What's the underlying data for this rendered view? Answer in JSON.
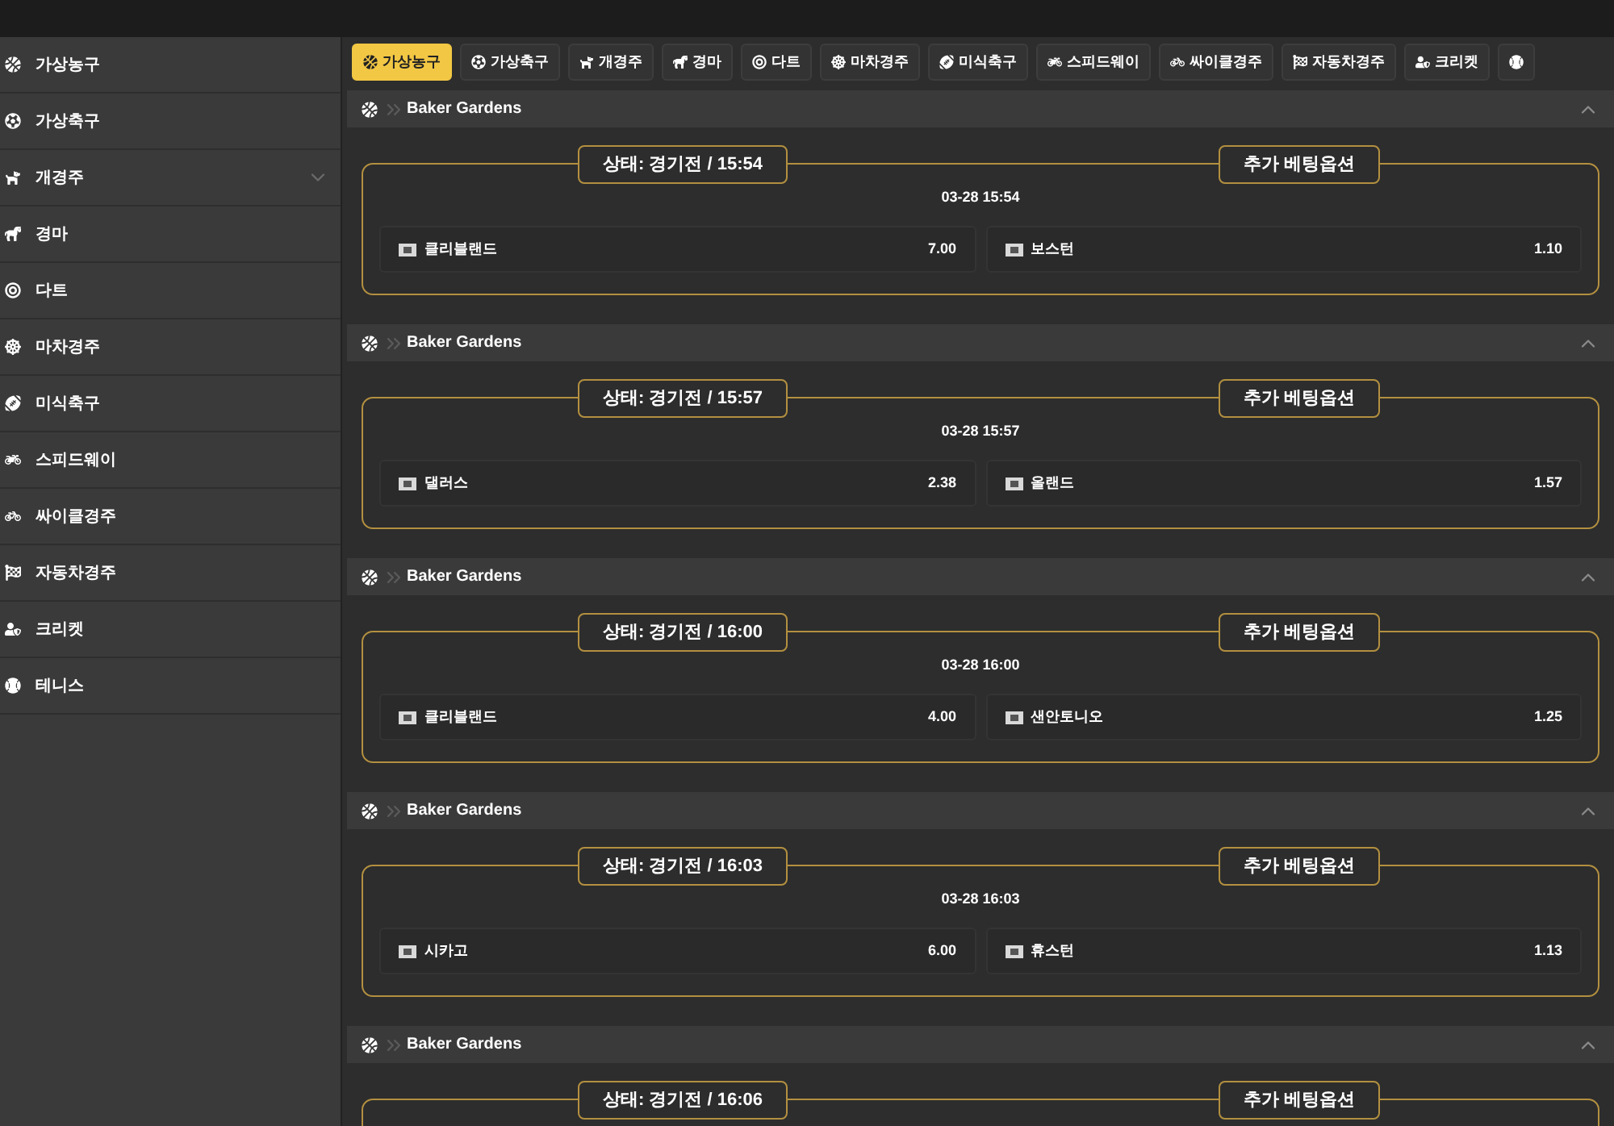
{
  "sidebar": {
    "items": [
      {
        "label": "가상농구",
        "kind": "basketball",
        "expandable": false
      },
      {
        "label": "가상축구",
        "kind": "soccer",
        "expandable": false
      },
      {
        "label": "개경주",
        "kind": "dog",
        "expandable": true
      },
      {
        "label": "경마",
        "kind": "horse",
        "expandable": false
      },
      {
        "label": "다트",
        "kind": "target",
        "expandable": false
      },
      {
        "label": "마차경주",
        "kind": "wheel",
        "expandable": false
      },
      {
        "label": "미식축구",
        "kind": "football",
        "expandable": false
      },
      {
        "label": "스피드웨이",
        "kind": "motorcycle",
        "expandable": false
      },
      {
        "label": "싸이클경주",
        "kind": "bicycle",
        "expandable": false
      },
      {
        "label": "자동차경주",
        "kind": "flag",
        "expandable": false
      },
      {
        "label": "크리켓",
        "kind": "person",
        "expandable": false
      },
      {
        "label": "테니스",
        "kind": "ball",
        "expandable": false
      }
    ]
  },
  "tabs": [
    {
      "label": "가상농구",
      "kind": "basketball",
      "selected": true
    },
    {
      "label": "가상축구",
      "kind": "soccer",
      "selected": false
    },
    {
      "label": "개경주",
      "kind": "dog",
      "selected": false
    },
    {
      "label": "경마",
      "kind": "horse",
      "selected": false
    },
    {
      "label": "다트",
      "kind": "target",
      "selected": false
    },
    {
      "label": "마차경주",
      "kind": "wheel",
      "selected": false
    },
    {
      "label": "미식축구",
      "kind": "football",
      "selected": false
    },
    {
      "label": "스피드웨이",
      "kind": "motorcycle",
      "selected": false
    },
    {
      "label": "싸이클경주",
      "kind": "bicycle",
      "selected": false
    },
    {
      "label": "자동차경주",
      "kind": "flag",
      "selected": false
    },
    {
      "label": "크리켓",
      "kind": "person",
      "selected": false
    },
    {
      "kind": "ball",
      "selected": false
    }
  ],
  "matches": [
    {
      "league": "Baker Gardens",
      "expanded": true,
      "status": "상태: 경기전 / 15:54",
      "extra": "추가 베팅옵션",
      "date": "03-28 15:54",
      "home": {
        "name": "클리블랜드",
        "odds": "7.00"
      },
      "away": {
        "name": "보스턴",
        "odds": "1.10"
      }
    },
    {
      "league": "Baker Gardens",
      "expanded": true,
      "status": "상태: 경기전 / 15:57",
      "extra": "추가 베팅옵션",
      "date": "03-28 15:57",
      "home": {
        "name": "댈러스",
        "odds": "2.38"
      },
      "away": {
        "name": "올랜드",
        "odds": "1.57"
      }
    },
    {
      "league": "Baker Gardens",
      "expanded": true,
      "status": "상태: 경기전 / 16:00",
      "extra": "추가 베팅옵션",
      "date": "03-28 16:00",
      "home": {
        "name": "클리블랜드",
        "odds": "4.00"
      },
      "away": {
        "name": "샌안토니오",
        "odds": "1.25"
      }
    },
    {
      "league": "Baker Gardens",
      "expanded": true,
      "status": "상태: 경기전 / 16:03",
      "extra": "추가 베팅옵션",
      "date": "03-28 16:03",
      "home": {
        "name": "시카고",
        "odds": "6.00"
      },
      "away": {
        "name": "휴스턴",
        "odds": "1.13"
      }
    },
    {
      "league": "Baker Gardens",
      "expanded": true,
      "status": "상태: 경기전 / 16:06",
      "extra": "추가 베팅옵션"
    }
  ]
}
